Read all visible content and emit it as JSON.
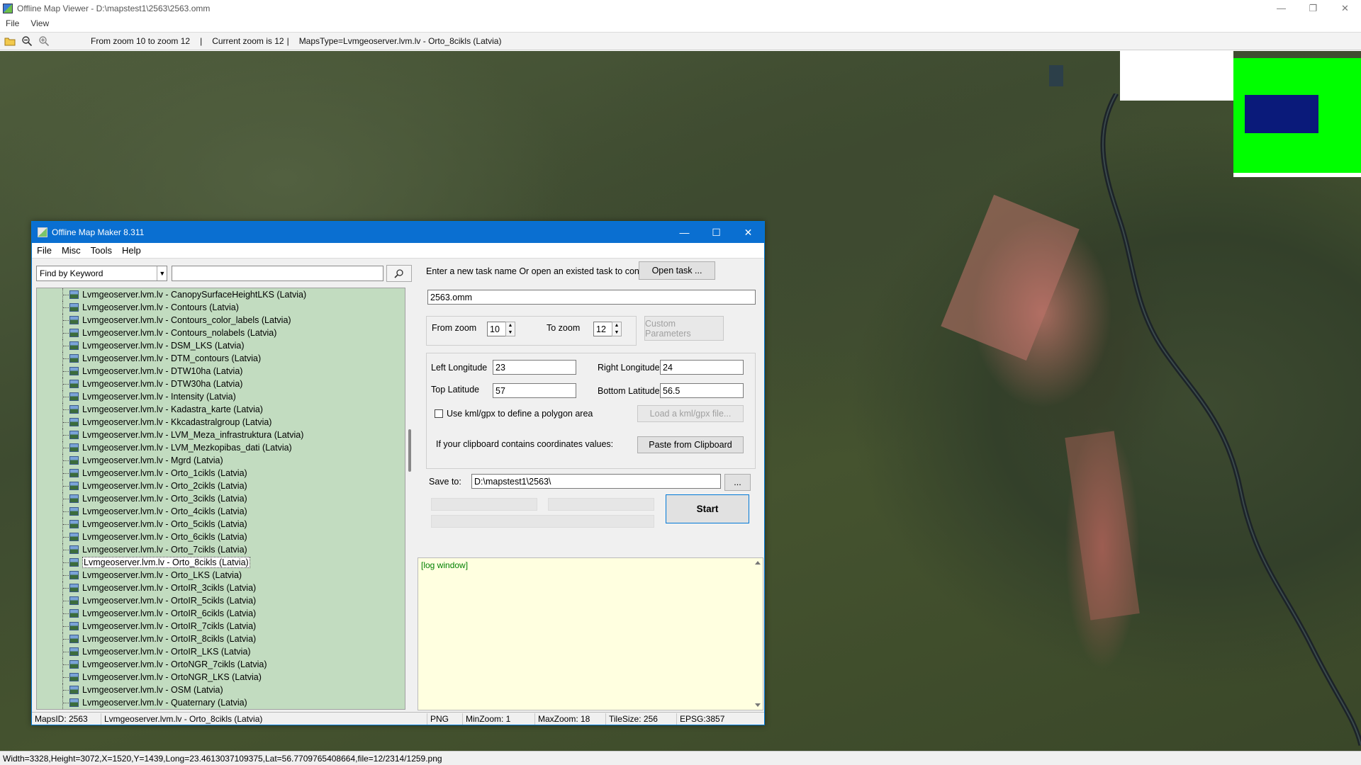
{
  "viewer": {
    "title": "Offline Map Viewer - D:\\mapstest1\\2563\\2563.omm",
    "menu": [
      "File",
      "View"
    ],
    "toolbar": {
      "zoom_range": "From zoom 10 to zoom 12",
      "current_zoom": "Current zoom is 12",
      "maps_type": "MapsType=Lvmgeoserver.lvm.lv - Orto_8cikls (Latvia)",
      "separator": "|"
    },
    "status": "Width=3328,Height=3072,X=1520,Y=1439,Long=23.4613037109375,Lat=56.7709765408664,file=12/2314/1259.png",
    "window_controls": {
      "minimize": "—",
      "maximize": "❐",
      "close": "✕"
    }
  },
  "dialog": {
    "title": "Offline Map Maker 8.311",
    "menu": [
      "File",
      "Misc",
      "Tools",
      "Help"
    ],
    "window_controls": {
      "minimize": "—",
      "maximize": "☐",
      "close": "✕"
    },
    "search": {
      "mode": "Find by Keyword",
      "query": ""
    },
    "tree_items": [
      "Lvmgeoserver.lvm.lv - CanopySurfaceHeightLKS (Latvia)",
      "Lvmgeoserver.lvm.lv - Contours (Latvia)",
      "Lvmgeoserver.lvm.lv - Contours_color_labels (Latvia)",
      "Lvmgeoserver.lvm.lv - Contours_nolabels (Latvia)",
      "Lvmgeoserver.lvm.lv - DSM_LKS (Latvia)",
      "Lvmgeoserver.lvm.lv - DTM_contours (Latvia)",
      "Lvmgeoserver.lvm.lv - DTW10ha (Latvia)",
      "Lvmgeoserver.lvm.lv - DTW30ha (Latvia)",
      "Lvmgeoserver.lvm.lv - Intensity (Latvia)",
      "Lvmgeoserver.lvm.lv - Kadastra_karte (Latvia)",
      "Lvmgeoserver.lvm.lv - Kkcadastralgroup (Latvia)",
      "Lvmgeoserver.lvm.lv - LVM_Meza_infrastruktura (Latvia)",
      "Lvmgeoserver.lvm.lv - LVM_Mezkopibas_dati (Latvia)",
      "Lvmgeoserver.lvm.lv - Mgrd (Latvia)",
      "Lvmgeoserver.lvm.lv - Orto_1cikls (Latvia)",
      "Lvmgeoserver.lvm.lv - Orto_2cikls (Latvia)",
      "Lvmgeoserver.lvm.lv - Orto_3cikls (Latvia)",
      "Lvmgeoserver.lvm.lv - Orto_4cikls (Latvia)",
      "Lvmgeoserver.lvm.lv - Orto_5cikls (Latvia)",
      "Lvmgeoserver.lvm.lv - Orto_6cikls (Latvia)",
      "Lvmgeoserver.lvm.lv - Orto_7cikls (Latvia)",
      "Lvmgeoserver.lvm.lv - Orto_8cikls (Latvia)",
      "Lvmgeoserver.lvm.lv - Orto_LKS (Latvia)",
      "Lvmgeoserver.lvm.lv - OrtoIR_3cikls (Latvia)",
      "Lvmgeoserver.lvm.lv - OrtoIR_5cikls (Latvia)",
      "Lvmgeoserver.lvm.lv - OrtoIR_6cikls (Latvia)",
      "Lvmgeoserver.lvm.lv - OrtoIR_7cikls (Latvia)",
      "Lvmgeoserver.lvm.lv - OrtoIR_8cikls (Latvia)",
      "Lvmgeoserver.lvm.lv - OrtoIR_LKS (Latvia)",
      "Lvmgeoserver.lvm.lv - OrtoNGR_7cikls (Latvia)",
      "Lvmgeoserver.lvm.lv - OrtoNGR_LKS (Latvia)",
      "Lvmgeoserver.lvm.lv - OSM (Latvia)",
      "Lvmgeoserver.lvm.lv - Quaternary (Latvia)"
    ],
    "selected_index": 21,
    "task": {
      "prompt": "Enter a new task name Or open an existed task to continue:",
      "open_label": "Open task ...",
      "name": "2563.omm"
    },
    "zoom": {
      "from_label": "From zoom",
      "from_value": "10",
      "to_label": "To zoom",
      "to_value": "12",
      "custom_label": "Custom Parameters"
    },
    "coords": {
      "left_lon_label": "Left Longitude",
      "left_lon": "23",
      "right_lon_label": "Right Longitude",
      "right_lon": "24",
      "top_lat_label": "Top Latitude",
      "top_lat": "57",
      "bottom_lat_label": "Bottom Latitude",
      "bottom_lat": "56.5",
      "kml_label": "Use kml/gpx to define a polygon area",
      "kml_button": "Load a kml/gpx file...",
      "clipboard_label": "If your clipboard contains coordinates values:",
      "clipboard_button": "Paste from Clipboard"
    },
    "save": {
      "label": "Save to:",
      "path": "D:\\mapstest1\\2563\\",
      "browse": "..."
    },
    "start_label": "Start",
    "log_text": "[log window]",
    "status": {
      "maps_id": "MapsID: 2563",
      "map_name": "Lvmgeoserver.lvm.lv - Orto_8cikls (Latvia)",
      "format": "PNG",
      "min_zoom": "MinZoom: 1",
      "max_zoom": "MaxZoom: 18",
      "tile_size": "TileSize: 256",
      "epsg": "EPSG:3857"
    }
  },
  "colors": {
    "dialog_title": "#0a6fd1",
    "tree_bg": "#c2dcc0",
    "log_bg": "#ffffe0",
    "overlay_green": "#00ff00",
    "overlay_blue": "#0a1a7a"
  },
  "icons": [
    "app-icon",
    "open-folder-icon",
    "zoom-out-icon",
    "zoom-in-icon",
    "search-icon",
    "map-layer-icon"
  ]
}
